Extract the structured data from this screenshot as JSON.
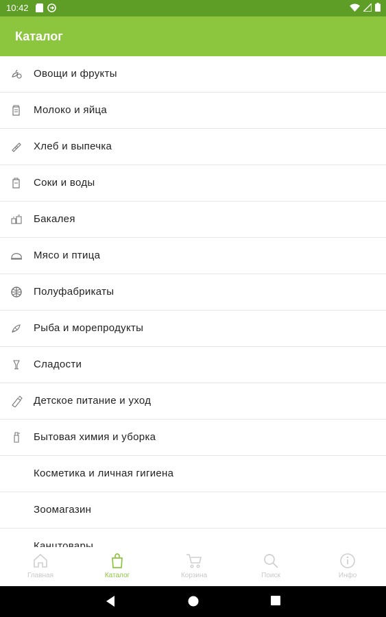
{
  "status_bar": {
    "time": "10:42"
  },
  "app_bar": {
    "title": "Каталог"
  },
  "categories": [
    {
      "label": "Овощи и фрукты",
      "icon": "vegetables-icon"
    },
    {
      "label": "Молоко и яйца",
      "icon": "milk-icon"
    },
    {
      "label": "Хлеб и выпечка",
      "icon": "bread-icon"
    },
    {
      "label": "Соки и воды",
      "icon": "juice-icon"
    },
    {
      "label": "Бакалея",
      "icon": "grocery-icon"
    },
    {
      "label": "Мясо и птица",
      "icon": "meat-icon"
    },
    {
      "label": "Полуфабрикаты",
      "icon": "semi-finished-icon"
    },
    {
      "label": "Рыба и морепродукты",
      "icon": "fish-icon"
    },
    {
      "label": "Сладости",
      "icon": "sweets-icon"
    },
    {
      "label": "Детское питание и уход",
      "icon": "baby-food-icon"
    },
    {
      "label": "Бытовая химия и уборка",
      "icon": "household-icon"
    },
    {
      "label": "Косметика и личная гигиена",
      "icon": ""
    },
    {
      "label": "Зоомагазин",
      "icon": ""
    },
    {
      "label": "Канцтовары",
      "icon": ""
    }
  ],
  "bottom_nav": [
    {
      "label": "Главная",
      "icon": "home-icon",
      "active": false
    },
    {
      "label": "Каталог",
      "icon": "shopping-bag-icon",
      "active": true
    },
    {
      "label": "Корзина",
      "icon": "cart-icon",
      "active": false
    },
    {
      "label": "Поиск",
      "icon": "search-icon",
      "active": false
    },
    {
      "label": "Инфо",
      "icon": "info-icon",
      "active": false
    }
  ],
  "colors": {
    "status_bar": "#5e9e26",
    "app_bar": "#8cc63f",
    "active_nav": "#8cc63f",
    "inactive_nav": "#c8c8c8"
  }
}
